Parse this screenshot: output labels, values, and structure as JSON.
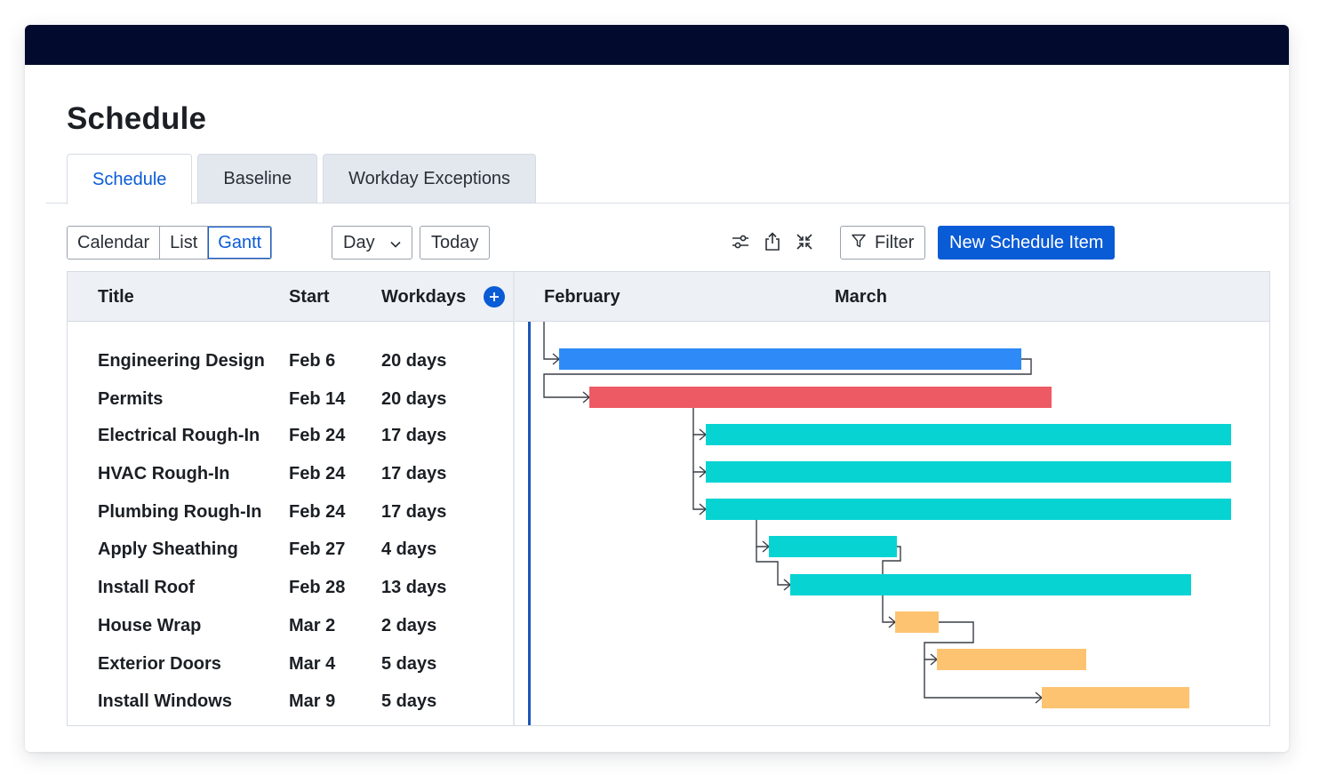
{
  "page": {
    "title": "Schedule"
  },
  "tabs": [
    {
      "label": "Schedule",
      "active": true
    },
    {
      "label": "Baseline",
      "active": false
    },
    {
      "label": "Workday Exceptions",
      "active": false
    }
  ],
  "view_toggle": [
    {
      "label": "Calendar",
      "active": false
    },
    {
      "label": "List",
      "active": false
    },
    {
      "label": "Gantt",
      "active": true
    }
  ],
  "toolbar": {
    "scale_value": "Day",
    "today_label": "Today",
    "filter_label": "Filter",
    "new_item_label": "New Schedule Item",
    "icons": [
      "settings-sliders-icon",
      "export-icon",
      "collapse-icon",
      "filter-icon",
      "chevron-down-icon"
    ]
  },
  "table": {
    "headers": {
      "title": "Title",
      "start": "Start",
      "workdays": "Workdays"
    },
    "rows": [
      {
        "title": "Engineering Design",
        "start": "Feb 6",
        "workdays": "20 days"
      },
      {
        "title": "Permits",
        "start": "Feb 14",
        "workdays": "20 days"
      },
      {
        "title": "Electrical Rough-In",
        "start": "Feb 24",
        "workdays": "17 days"
      },
      {
        "title": "HVAC Rough-In",
        "start": "Feb 24",
        "workdays": "17 days"
      },
      {
        "title": "Plumbing Rough-In",
        "start": "Feb 24",
        "workdays": "17 days"
      },
      {
        "title": "Apply Sheathing",
        "start": "Feb 27",
        "workdays": "4 days"
      },
      {
        "title": "Install Roof",
        "start": "Feb 28",
        "workdays": "13 days"
      },
      {
        "title": "House Wrap",
        "start": "Mar 2",
        "workdays": "2 days"
      },
      {
        "title": "Exterior Doors",
        "start": "Mar 4",
        "workdays": "5 days"
      },
      {
        "title": "Install Windows",
        "start": "Mar 9",
        "workdays": "5 days"
      }
    ]
  },
  "timeline": {
    "months": [
      "February",
      "March"
    ],
    "bar_colors": {
      "design": "#2e8af6",
      "permits": "#ee5a64",
      "framing": "#07d3d3",
      "exterior": "#fdc370"
    }
  }
}
